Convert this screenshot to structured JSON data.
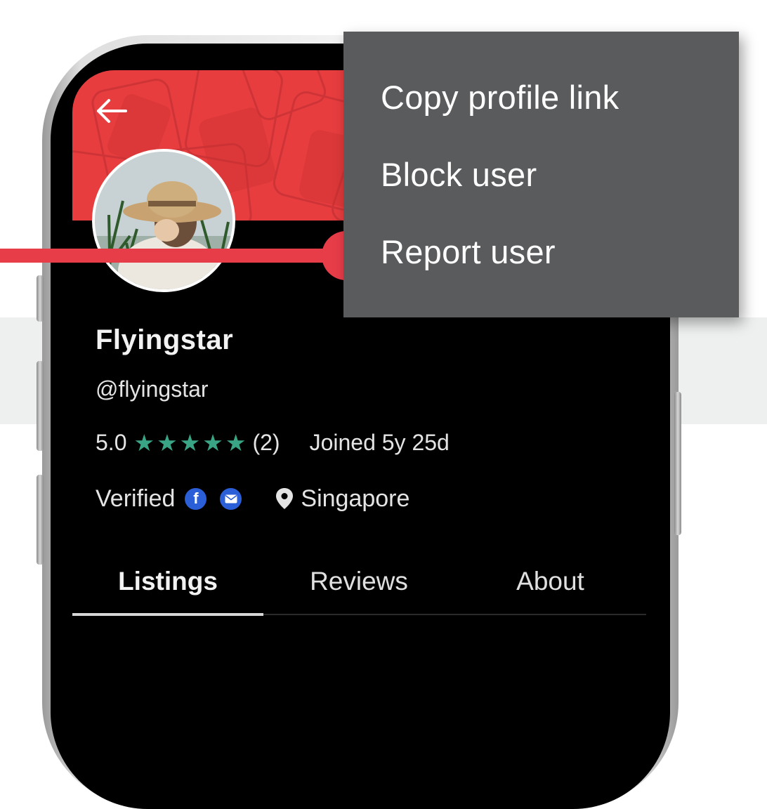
{
  "profile": {
    "username": "Flyingstar",
    "handle": "@flyingstar",
    "rating": "5.0",
    "review_count": "(2)",
    "stars": 5,
    "joined": "Joined 5y 25d",
    "verified_label": "Verified",
    "verified_badges": [
      "facebook-icon",
      "email-icon"
    ],
    "location": "Singapore"
  },
  "tabs": [
    {
      "label": "Listings",
      "active": true
    },
    {
      "label": "Reviews",
      "active": false
    },
    {
      "label": "About",
      "active": false
    }
  ],
  "menu": {
    "items": [
      "Copy profile link",
      "Block user",
      "Report user"
    ],
    "highlighted": "Report user"
  },
  "colors": {
    "banner": "#e73d3f",
    "star": "#3aa585",
    "menu_bg": "#5a5b5d",
    "callout": "#e73d48",
    "badge": "#2b5fd8"
  },
  "icons": {
    "back": "arrow-left-icon",
    "location": "map-pin-icon",
    "star": "star-icon"
  }
}
